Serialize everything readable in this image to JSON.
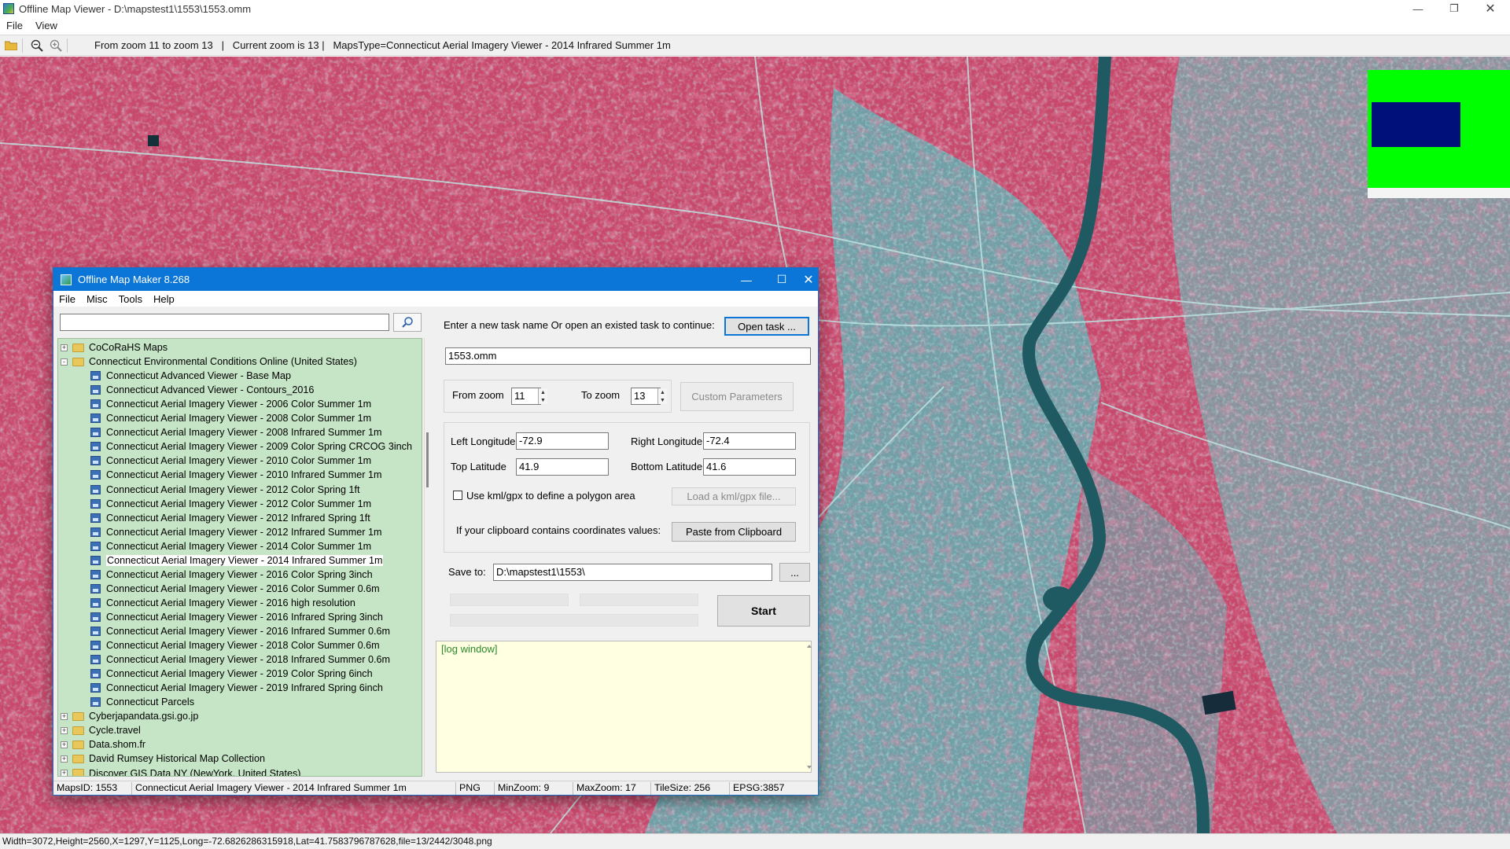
{
  "viewer": {
    "title": "Offline Map Viewer - D:\\mapstest1\\1553\\1553.omm",
    "menu": [
      "File",
      "View"
    ],
    "toolbar_info": "From zoom 11 to zoom 13   |   Current zoom is 13 |   MapsType=Connecticut Aerial Imagery Viewer - 2014 Infrared Summer 1m",
    "status": "Width=3072,Height=2560,X=1297,Y=1125,Long=-72.6826286315918,Lat=41.7583796787628,file=13/2442/3048.png"
  },
  "dialog": {
    "title": "Offline Map Maker 8.268",
    "menu": [
      "File",
      "Misc",
      "Tools",
      "Help"
    ],
    "search_value": "",
    "tree": [
      {
        "label": "CoCoRaHS Maps",
        "level": 0,
        "expander": "+"
      },
      {
        "label": "Connecticut Environmental Conditions Online (United States)",
        "level": 0,
        "expander": "-"
      },
      {
        "label": "Connecticut Advanced Viewer - Base Map",
        "level": 1
      },
      {
        "label": "Connecticut Advanced Viewer - Contours_2016",
        "level": 1
      },
      {
        "label": "Connecticut Aerial Imagery Viewer - 2006 Color Summer 1m",
        "level": 1
      },
      {
        "label": "Connecticut Aerial Imagery Viewer - 2008 Color Summer 1m",
        "level": 1
      },
      {
        "label": "Connecticut Aerial Imagery Viewer - 2008 Infrared Summer 1m",
        "level": 1
      },
      {
        "label": "Connecticut Aerial Imagery Viewer - 2009 Color Spring CRCOG 3inch",
        "level": 1
      },
      {
        "label": "Connecticut Aerial Imagery Viewer - 2010 Color Summer 1m",
        "level": 1
      },
      {
        "label": "Connecticut Aerial Imagery Viewer - 2010 Infrared Summer 1m",
        "level": 1
      },
      {
        "label": "Connecticut Aerial Imagery Viewer - 2012 Color Spring 1ft",
        "level": 1
      },
      {
        "label": "Connecticut Aerial Imagery Viewer - 2012 Color Summer 1m",
        "level": 1
      },
      {
        "label": "Connecticut Aerial Imagery Viewer - 2012 Infrared Spring 1ft",
        "level": 1
      },
      {
        "label": "Connecticut Aerial Imagery Viewer - 2012 Infrared Summer 1m",
        "level": 1
      },
      {
        "label": "Connecticut Aerial Imagery Viewer - 2014 Color Summer 1m",
        "level": 1
      },
      {
        "label": "Connecticut Aerial Imagery Viewer - 2014 Infrared Summer 1m",
        "level": 1,
        "selected": true
      },
      {
        "label": "Connecticut Aerial Imagery Viewer - 2016 Color Spring 3inch",
        "level": 1
      },
      {
        "label": "Connecticut Aerial Imagery Viewer - 2016 Color Summer 0.6m",
        "level": 1
      },
      {
        "label": "Connecticut Aerial Imagery Viewer - 2016 high resolution",
        "level": 1
      },
      {
        "label": "Connecticut Aerial Imagery Viewer - 2016 Infrared Spring 3inch",
        "level": 1
      },
      {
        "label": "Connecticut Aerial Imagery Viewer - 2016 Infrared Summer 0.6m",
        "level": 1
      },
      {
        "label": "Connecticut Aerial Imagery Viewer - 2018 Color Summer 0.6m",
        "level": 1
      },
      {
        "label": "Connecticut Aerial Imagery Viewer - 2018 Infrared Summer 0.6m",
        "level": 1
      },
      {
        "label": "Connecticut Aerial Imagery Viewer - 2019 Color Spring 6inch",
        "level": 1
      },
      {
        "label": "Connecticut Aerial Imagery Viewer - 2019 Infrared Spring 6inch",
        "level": 1
      },
      {
        "label": "Connecticut Parcels",
        "level": 1
      },
      {
        "label": "Cyberjapandata.gsi.go.jp",
        "level": 0,
        "expander": "+"
      },
      {
        "label": "Cycle.travel",
        "level": 0,
        "expander": "+"
      },
      {
        "label": "Data.shom.fr",
        "level": 0,
        "expander": "+"
      },
      {
        "label": "David Rumsey Historical Map Collection",
        "level": 0,
        "expander": "+"
      },
      {
        "label": "Discover GIS Data NY (NewYork, United States)",
        "level": 0,
        "expander": "+"
      }
    ],
    "task_prompt": "Enter a new task name Or open an existed task to continue:",
    "open_task_label": "Open task ...",
    "task_name": "1553.omm",
    "from_zoom_label": "From zoom",
    "from_zoom": "11",
    "to_zoom_label": "To zoom",
    "to_zoom": "13",
    "custom_params_label": "Custom Parameters",
    "left_lon_label": "Left Longitude",
    "left_lon": "-72.9",
    "right_lon_label": "Right Longitude",
    "right_lon": "-72.4",
    "top_lat_label": "Top Latitude",
    "top_lat": "41.9",
    "bottom_lat_label": "Bottom Latitude",
    "bottom_lat": "41.6",
    "kml_checkbox_label": "Use kml/gpx to define a polygon area",
    "kml_checked": false,
    "load_kml_label": "Load a kml/gpx file...",
    "clipboard_text": "If your clipboard contains coordinates values:",
    "paste_label": "Paste from Clipboard",
    "save_to_label": "Save to:",
    "save_to": "D:\\mapstest1\\1553\\",
    "browse_label": "...",
    "start_label": "Start",
    "log_text": "[log window]",
    "status": {
      "maps_id": "MapsID: 1553",
      "maps_name": "Connecticut Aerial Imagery Viewer - 2014 Infrared Summer 1m",
      "format": "PNG",
      "min_zoom": "MinZoom: 9",
      "max_zoom": "MaxZoom: 17",
      "tile_size": "TileSize: 256",
      "epsg": "EPSG:3857"
    }
  },
  "colors": {
    "map_vegetation": "#c9476a",
    "map_urban": "#5fb4b4",
    "river": "#1f5a62",
    "overview_green": "#00ff00",
    "overview_box": "#00107a",
    "tree_bg": "#c6e4c6",
    "title_blue": "#0b76d8",
    "log_bg": "#ffffe1"
  }
}
